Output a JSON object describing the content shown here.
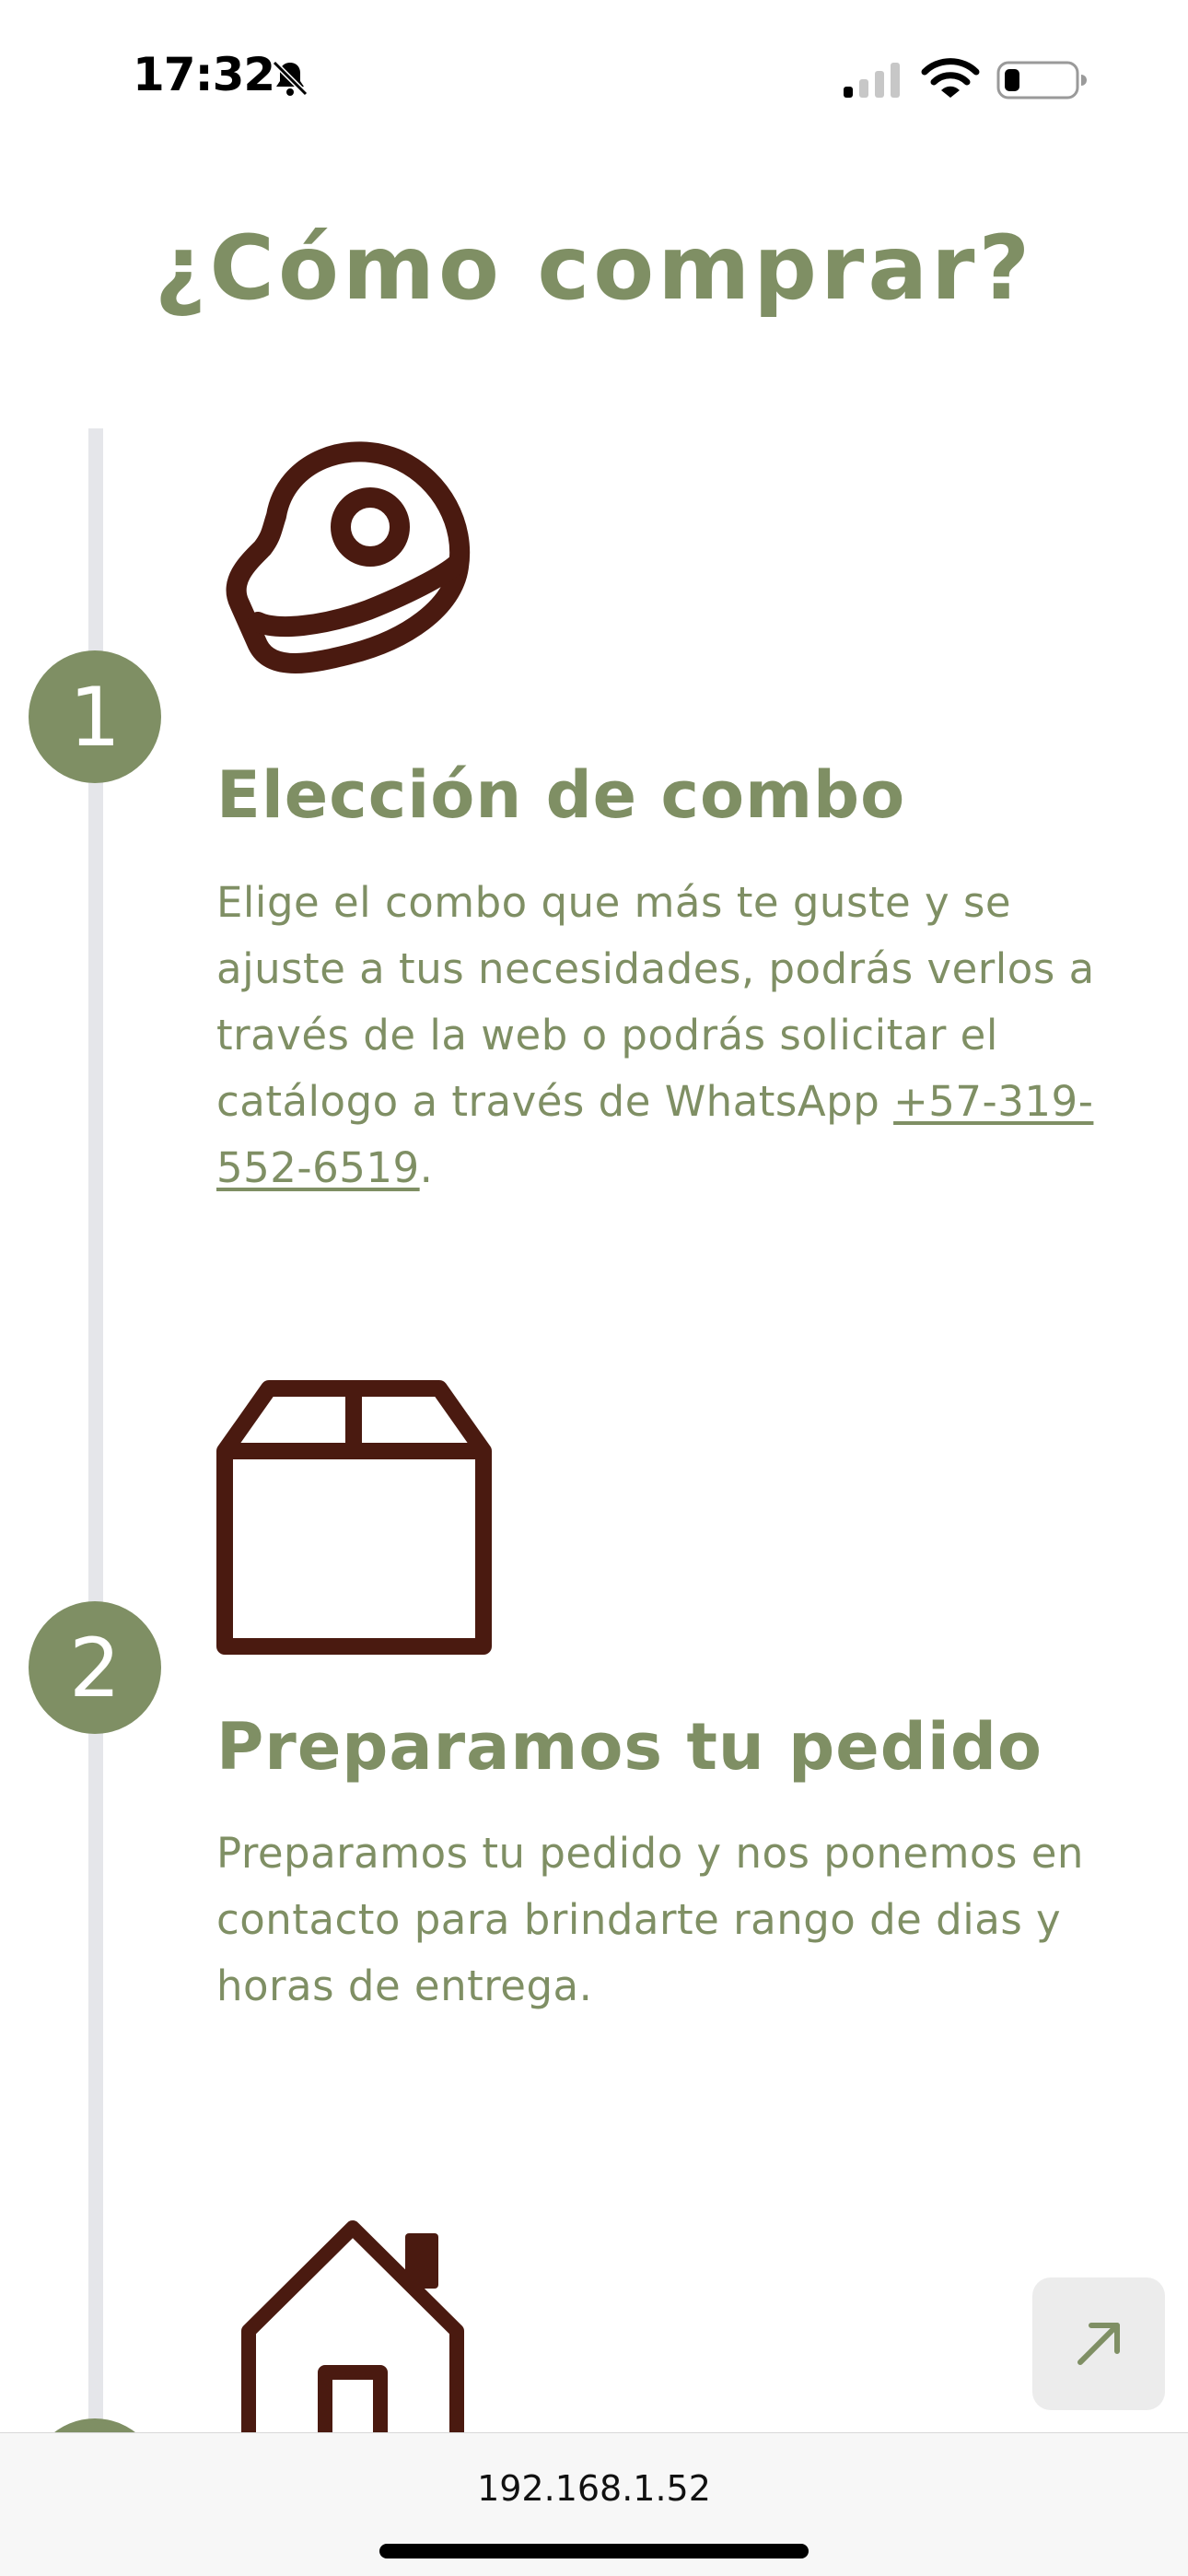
{
  "status_bar": {
    "time": "17:32",
    "icons": [
      "bell-slash-icon",
      "cellular-signal-icon",
      "wifi-icon",
      "battery-icon"
    ]
  },
  "page": {
    "title": "¿Cómo comprar?"
  },
  "steps": [
    {
      "number": "1",
      "icon": "meat-steak-icon",
      "title": "Elección de combo",
      "description": "Elige el combo que más te guste y se ajuste a tus necesidades, podrás verlos a través de la web o podrás solicitar el catálogo a través de WhatsApp ",
      "link_text": "+57-319-552-6519",
      "after_link": "."
    },
    {
      "number": "2",
      "icon": "box-icon",
      "title": "Preparamos tu pedido",
      "description": "Preparamos tu pedido y nos ponemos en contacto para brindarte rango de dias y horas de entrega."
    },
    {
      "icon": "house-icon"
    }
  ],
  "fab": {
    "icon": "arrow-up-right-icon"
  },
  "address_bar": {
    "url": "192.168.1.52"
  },
  "colors": {
    "accent": "#7f8f64",
    "icon_brown": "#4a1a10",
    "timeline": "#e5e6ea"
  }
}
